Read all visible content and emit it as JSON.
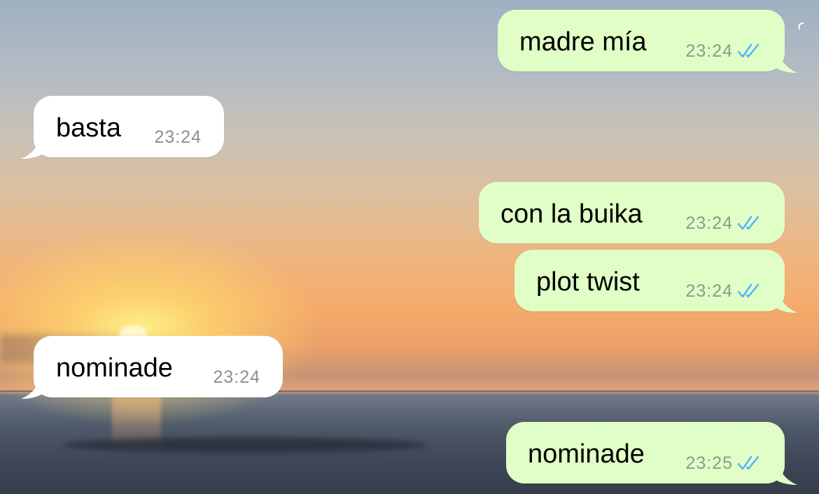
{
  "chat": {
    "messages": [
      {
        "direction": "outgoing",
        "text": "madre mía",
        "time": "23:24",
        "status": "read-double-check-icon"
      },
      {
        "direction": "incoming",
        "text": "basta",
        "time": "23:24"
      },
      {
        "direction": "outgoing",
        "text": "con la buika",
        "time": "23:24",
        "status": "read-double-check-icon"
      },
      {
        "direction": "outgoing",
        "text": "plot twist",
        "time": "23:24",
        "status": "read-double-check-icon"
      },
      {
        "direction": "incoming",
        "text": "nominade",
        "time": "23:24"
      },
      {
        "direction": "outgoing",
        "text": "nominade",
        "time": "23:25",
        "status": "read-double-check-icon"
      }
    ]
  },
  "colors": {
    "outgoing_bubble": "#e1fec6",
    "incoming_bubble": "#ffffff",
    "read_check": "#4fb3f6",
    "timestamp": "#8e9a8a"
  }
}
